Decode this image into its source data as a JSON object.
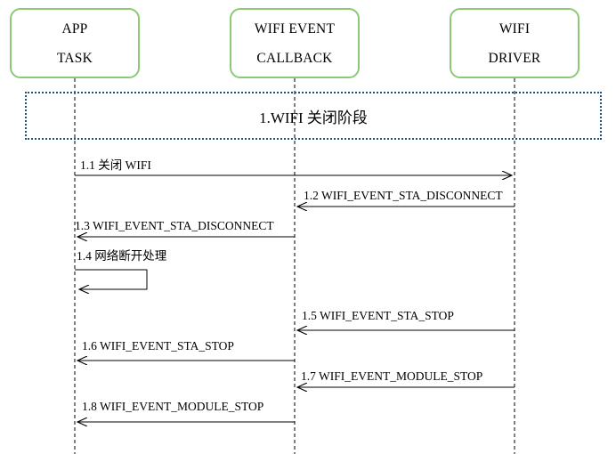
{
  "actors": {
    "app": [
      "APP",
      "TASK"
    ],
    "callback": [
      "WIFI EVENT",
      "CALLBACK"
    ],
    "driver": [
      "WIFI",
      "DRIVER"
    ]
  },
  "phase": {
    "title": "1.WIFI 关闭阶段"
  },
  "messages": [
    {
      "label": "1.1  关闭 WIFI",
      "from": "app",
      "to": "driver"
    },
    {
      "label": "1.2  WIFI_EVENT_STA_DISCONNECT",
      "from": "driver",
      "to": "callback"
    },
    {
      "label": "1.3  WIFI_EVENT_STA_DISCONNECT",
      "from": "callback",
      "to": "app"
    },
    {
      "label": "1.4  网络断开处理",
      "from": "app",
      "to": "app"
    },
    {
      "label": "1.5  WIFI_EVENT_STA_STOP",
      "from": "driver",
      "to": "callback"
    },
    {
      "label": "1.6  WIFI_EVENT_STA_STOP",
      "from": "callback",
      "to": "app"
    },
    {
      "label": "1.7  WIFI_EVENT_MODULE_STOP",
      "from": "driver",
      "to": "callback"
    },
    {
      "label": "1.8  WIFI_EVENT_MODULE_STOP",
      "from": "callback",
      "to": "app"
    }
  ]
}
